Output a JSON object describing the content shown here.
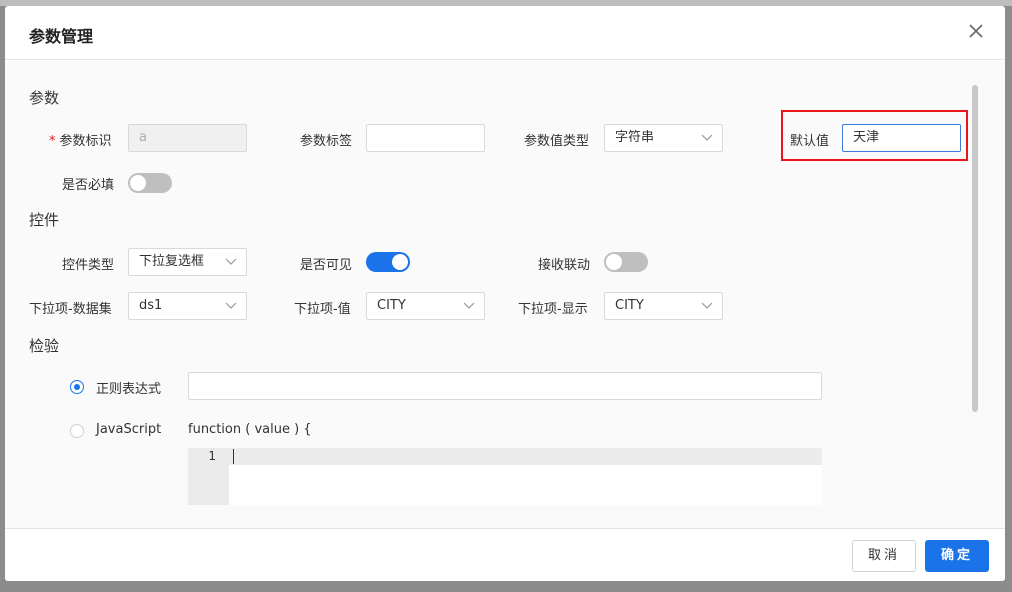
{
  "dialog": {
    "title": "参数管理"
  },
  "sections": {
    "param": "参数",
    "control": "控件",
    "validation": "检验"
  },
  "fields": {
    "param_id": {
      "label": "参数标识",
      "required_mark": "*",
      "value": "a"
    },
    "param_label": {
      "label": "参数标签",
      "value": ""
    },
    "value_type": {
      "label": "参数值类型",
      "value": "字符串"
    },
    "default_value": {
      "label": "默认值",
      "value": "天津"
    },
    "required": {
      "label": "是否必填",
      "on": false
    },
    "control_type": {
      "label": "控件类型",
      "value": "下拉复选框"
    },
    "visible": {
      "label": "是否可见",
      "on": true
    },
    "receive_link": {
      "label": "接收联动",
      "on": false
    },
    "dropdown_dataset": {
      "label": "下拉项-数据集",
      "value": "ds1"
    },
    "dropdown_value": {
      "label": "下拉项-值",
      "value": "CITY"
    },
    "dropdown_display": {
      "label": "下拉项-显示",
      "value": "CITY"
    }
  },
  "validation": {
    "regex": {
      "label": "正则表达式",
      "selected": true,
      "value": ""
    },
    "javascript": {
      "label": "JavaScript",
      "selected": false,
      "signature": "function ( value ) {",
      "line_number": "1"
    }
  },
  "footer": {
    "cancel_label": "取消",
    "ok_label": "确定"
  },
  "colors": {
    "primary": "#1a73e8",
    "highlight": "#e8161a"
  },
  "icons": {
    "close": "close-icon",
    "dropdown": "chevron-down-icon"
  }
}
